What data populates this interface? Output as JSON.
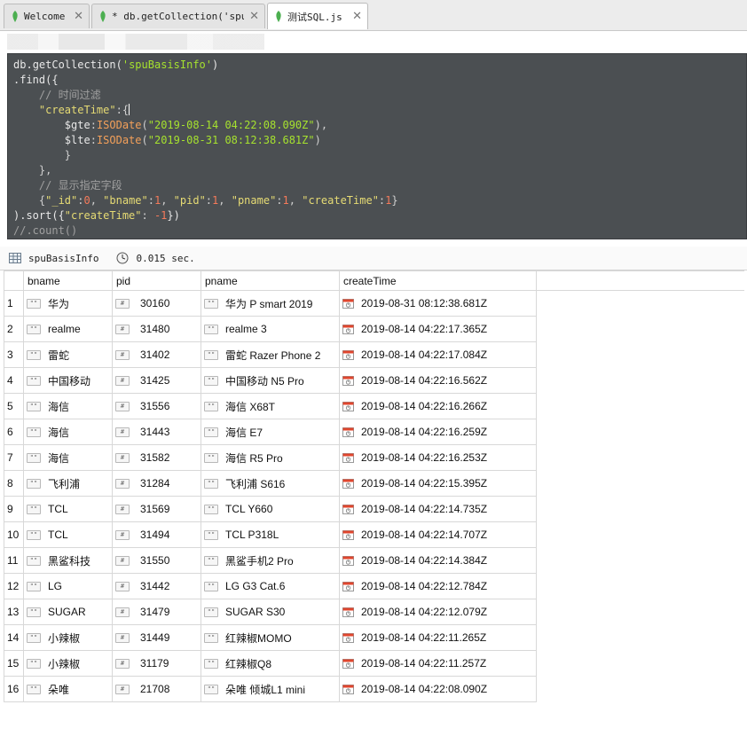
{
  "tabs": [
    {
      "label": "Welcome",
      "close": "✕"
    },
    {
      "label": "* db.getCollection('spuB…",
      "close": "✕"
    },
    {
      "label": "测试SQL.js",
      "close": "✕"
    }
  ],
  "editor": {
    "lines": [
      [
        {
          "c": "kw",
          "t": "db."
        },
        {
          "c": "kw",
          "t": "getCollection("
        },
        {
          "c": "str",
          "t": "'spuBasisInfo'"
        },
        {
          "c": "kw",
          "t": ")"
        }
      ],
      [
        {
          "c": "kw",
          "t": ".find({"
        }
      ],
      [
        {
          "c": "com",
          "t": "    // 时间过滤"
        }
      ],
      [
        {
          "c": "key",
          "t": "    \"createTime\""
        },
        {
          "c": "op",
          "t": ":{"
        }
      ],
      [
        {
          "c": "kw",
          "t": "        $gte"
        },
        {
          "c": "op",
          "t": ":"
        },
        {
          "c": "fn",
          "t": "ISODate"
        },
        {
          "c": "op",
          "t": "("
        },
        {
          "c": "str",
          "t": "\"2019-08-14 04:22:08.090Z\""
        },
        {
          "c": "op",
          "t": "),"
        }
      ],
      [
        {
          "c": "kw",
          "t": "        $lte"
        },
        {
          "c": "op",
          "t": ":"
        },
        {
          "c": "fn",
          "t": "ISODate"
        },
        {
          "c": "op",
          "t": "("
        },
        {
          "c": "str",
          "t": "\"2019-08-31 08:12:38.681Z\""
        },
        {
          "c": "op",
          "t": ")"
        }
      ],
      [
        {
          "c": "op",
          "t": "        }"
        }
      ],
      [
        {
          "c": "op",
          "t": "    },"
        }
      ],
      [
        {
          "c": "com",
          "t": "    // 显示指定字段"
        }
      ],
      [
        {
          "c": "op",
          "t": "    {"
        },
        {
          "c": "key",
          "t": "\"_id\""
        },
        {
          "c": "op",
          "t": ":"
        },
        {
          "c": "num",
          "t": "0"
        },
        {
          "c": "op",
          "t": ", "
        },
        {
          "c": "key",
          "t": "\"bname\""
        },
        {
          "c": "op",
          "t": ":"
        },
        {
          "c": "num",
          "t": "1"
        },
        {
          "c": "op",
          "t": ", "
        },
        {
          "c": "key",
          "t": "\"pid\""
        },
        {
          "c": "op",
          "t": ":"
        },
        {
          "c": "num",
          "t": "1"
        },
        {
          "c": "op",
          "t": ", "
        },
        {
          "c": "key",
          "t": "\"pname\""
        },
        {
          "c": "op",
          "t": ":"
        },
        {
          "c": "num",
          "t": "1"
        },
        {
          "c": "op",
          "t": ", "
        },
        {
          "c": "key",
          "t": "\"createTime\""
        },
        {
          "c": "op",
          "t": ":"
        },
        {
          "c": "num",
          "t": "1"
        },
        {
          "c": "op",
          "t": "}"
        }
      ],
      [
        {
          "c": "kw",
          "t": ").sort({"
        },
        {
          "c": "key",
          "t": "\"createTime\""
        },
        {
          "c": "op",
          "t": ": "
        },
        {
          "c": "num",
          "t": "-1"
        },
        {
          "c": "kw",
          "t": "})"
        }
      ],
      [
        {
          "c": "com",
          "t": "//.count()"
        }
      ]
    ]
  },
  "result": {
    "collection": "spuBasisInfo",
    "time": "0.015 sec."
  },
  "grid": {
    "columns": [
      "bname",
      "pid",
      "pname",
      "createTime"
    ],
    "rows": [
      {
        "n": "1",
        "bname": "华为",
        "pid": "30160",
        "pname": "华为 P smart 2019",
        "createTime": "2019-08-31 08:12:38.681Z"
      },
      {
        "n": "2",
        "bname": "realme",
        "pid": "31480",
        "pname": "realme 3",
        "createTime": "2019-08-14 04:22:17.365Z"
      },
      {
        "n": "3",
        "bname": "雷蛇",
        "pid": "31402",
        "pname": "雷蛇 Razer Phone 2",
        "createTime": "2019-08-14 04:22:17.084Z"
      },
      {
        "n": "4",
        "bname": "中国移动",
        "pid": "31425",
        "pname": "中国移动 N5 Pro",
        "createTime": "2019-08-14 04:22:16.562Z"
      },
      {
        "n": "5",
        "bname": "海信",
        "pid": "31556",
        "pname": "海信 X68T",
        "createTime": "2019-08-14 04:22:16.266Z"
      },
      {
        "n": "6",
        "bname": "海信",
        "pid": "31443",
        "pname": "海信 E7",
        "createTime": "2019-08-14 04:22:16.259Z"
      },
      {
        "n": "7",
        "bname": "海信",
        "pid": "31582",
        "pname": "海信 R5 Pro",
        "createTime": "2019-08-14 04:22:16.253Z"
      },
      {
        "n": "8",
        "bname": "飞利浦",
        "pid": "31284",
        "pname": "飞利浦 S616",
        "createTime": "2019-08-14 04:22:15.395Z"
      },
      {
        "n": "9",
        "bname": "TCL",
        "pid": "31569",
        "pname": "TCL Y660",
        "createTime": "2019-08-14 04:22:14.735Z"
      },
      {
        "n": "10",
        "bname": "TCL",
        "pid": "31494",
        "pname": "TCL P318L",
        "createTime": "2019-08-14 04:22:14.707Z"
      },
      {
        "n": "11",
        "bname": "黑鲨科技",
        "pid": "31550",
        "pname": "黑鲨手机2 Pro",
        "createTime": "2019-08-14 04:22:14.384Z"
      },
      {
        "n": "12",
        "bname": "LG",
        "pid": "31442",
        "pname": "LG G3 Cat.6",
        "createTime": "2019-08-14 04:22:12.784Z"
      },
      {
        "n": "13",
        "bname": "SUGAR",
        "pid": "31479",
        "pname": "SUGAR S30",
        "createTime": "2019-08-14 04:22:12.079Z"
      },
      {
        "n": "14",
        "bname": "小辣椒",
        "pid": "31449",
        "pname": "红辣椒MOMO",
        "createTime": "2019-08-14 04:22:11.265Z"
      },
      {
        "n": "15",
        "bname": "小辣椒",
        "pid": "31179",
        "pname": "红辣椒Q8",
        "createTime": "2019-08-14 04:22:11.257Z"
      },
      {
        "n": "16",
        "bname": "朵唯",
        "pid": "21708",
        "pname": "朵唯 倾城L1 mini",
        "createTime": "2019-08-14 04:22:08.090Z"
      }
    ]
  },
  "icons": {
    "tab": "mongodb-leaf-icon",
    "string": "string-type-icon",
    "number": "number-type-icon",
    "date": "date-type-icon",
    "collection": "table-icon",
    "time": "clock-icon"
  },
  "colors": {
    "leaf": "#4caf50",
    "editor_bg": "#4b4f52",
    "string": "#a6e22e",
    "number": "#f57a5a",
    "comment": "#a0a0a0",
    "function": "#f3a05a"
  }
}
